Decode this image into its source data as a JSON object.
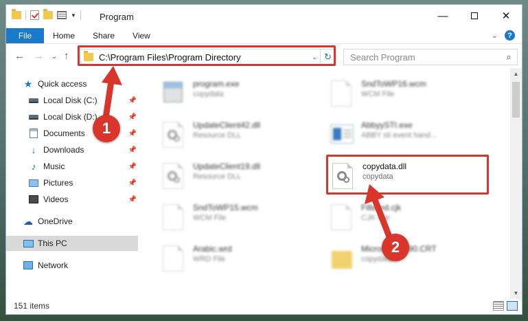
{
  "window": {
    "title": "Program",
    "controls": {
      "minimize": "—",
      "maximize": "",
      "close": "✕"
    }
  },
  "ribbon": {
    "tabs": [
      "File",
      "Home",
      "Share",
      "View"
    ],
    "expand_glyph": "⌄",
    "help_glyph": "?"
  },
  "nav": {
    "back": "←",
    "forward": "→",
    "dropdown": "⌄",
    "up": "↑",
    "address": "C:\\Program Files\\Program Directory",
    "address_dropdown": "⌄",
    "refresh": "↻",
    "search_placeholder": "Search Program",
    "search_icon": "⌕"
  },
  "sidebar": {
    "items": [
      {
        "label": "Quick access",
        "icon": "star-icon",
        "pinned": false
      },
      {
        "label": "Local Disk (C:)",
        "icon": "disk-icon",
        "pinned": true
      },
      {
        "label": "Local Disk (D:)",
        "icon": "disk-icon",
        "pinned": true
      },
      {
        "label": "Documents",
        "icon": "documents-icon",
        "pinned": true
      },
      {
        "label": "Downloads",
        "icon": "downloads-icon",
        "pinned": true
      },
      {
        "label": "Music",
        "icon": "music-icon",
        "pinned": true
      },
      {
        "label": "Pictures",
        "icon": "pictures-icon",
        "pinned": true
      },
      {
        "label": "Videos",
        "icon": "videos-icon",
        "pinned": true
      },
      {
        "label": "OneDrive",
        "icon": "cloud-icon",
        "pinned": false
      },
      {
        "label": "This PC",
        "icon": "computer-icon",
        "pinned": false,
        "selected": true
      },
      {
        "label": "Network",
        "icon": "network-icon",
        "pinned": false
      }
    ]
  },
  "files": [
    {
      "name": "program.exe",
      "type": "copydata",
      "icon": "exe-icon",
      "blurred": true
    },
    {
      "name": "SndToWP16.wcm",
      "type": "WCM File",
      "icon": "page-icon",
      "blurred": true
    },
    {
      "name": "UpdateClient42.dll",
      "type": "Resource DLL",
      "icon": "dll-icon",
      "blurred": true
    },
    {
      "name": "AbbyySTI.exe",
      "type": "ABBY sti event hand...",
      "icon": "app-icon",
      "blurred": true
    },
    {
      "name": "UpdateClient19.dll",
      "type": "Resource DLL",
      "icon": "dll-icon",
      "blurred": true
    },
    {
      "name": "copydata.dll",
      "type": "copydata",
      "icon": "dll-icon",
      "blurred": false
    },
    {
      "name": "SndToWP15.wcm",
      "type": "WCM File",
      "icon": "page-icon",
      "blurred": true
    },
    {
      "name": "Filtered.cjk",
      "type": "CJK File",
      "icon": "page-icon",
      "blurred": true
    },
    {
      "name": "Arabic.wrd",
      "type": "WRD File",
      "icon": "page-icon",
      "blurred": true
    },
    {
      "name": "Microsoft.VC90.CRT",
      "type": "copydata",
      "icon": "folder-icon",
      "blurred": true
    }
  ],
  "status": {
    "item_count": "151 items"
  },
  "callouts": [
    "1",
    "2"
  ],
  "colors": {
    "accent": "#1979ca",
    "callout": "#d9352b"
  }
}
